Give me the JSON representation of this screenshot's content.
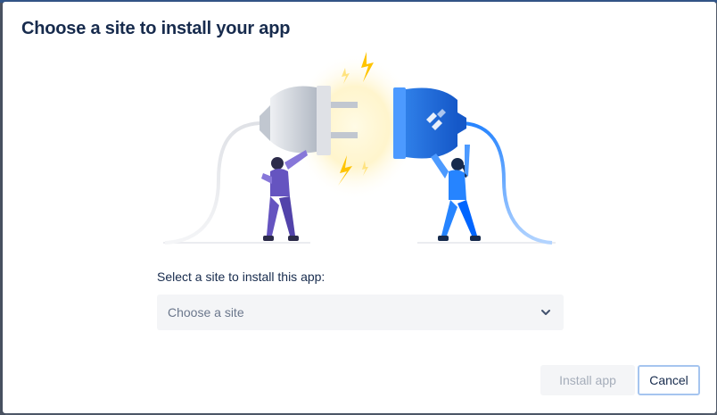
{
  "modal": {
    "title": "Choose a site to install your app"
  },
  "illustration": {
    "icon": "plug-connection-illustration"
  },
  "site_picker": {
    "label": "Select a site to install this app:",
    "placeholder": "Choose a site",
    "icon": "chevron-down-icon"
  },
  "footer": {
    "install_label": "Install app",
    "cancel_label": "Cancel"
  },
  "colors": {
    "title_text": "#172b4d",
    "plug_blue": "#1868db",
    "plug_gray": "#c1c7d0",
    "person_purple": "#6554c0",
    "spark_yellow": "#ffc400",
    "disabled_button_bg": "#f4f5f7",
    "disabled_button_text": "#a5adba",
    "focus_border": "#a6c5ef"
  }
}
